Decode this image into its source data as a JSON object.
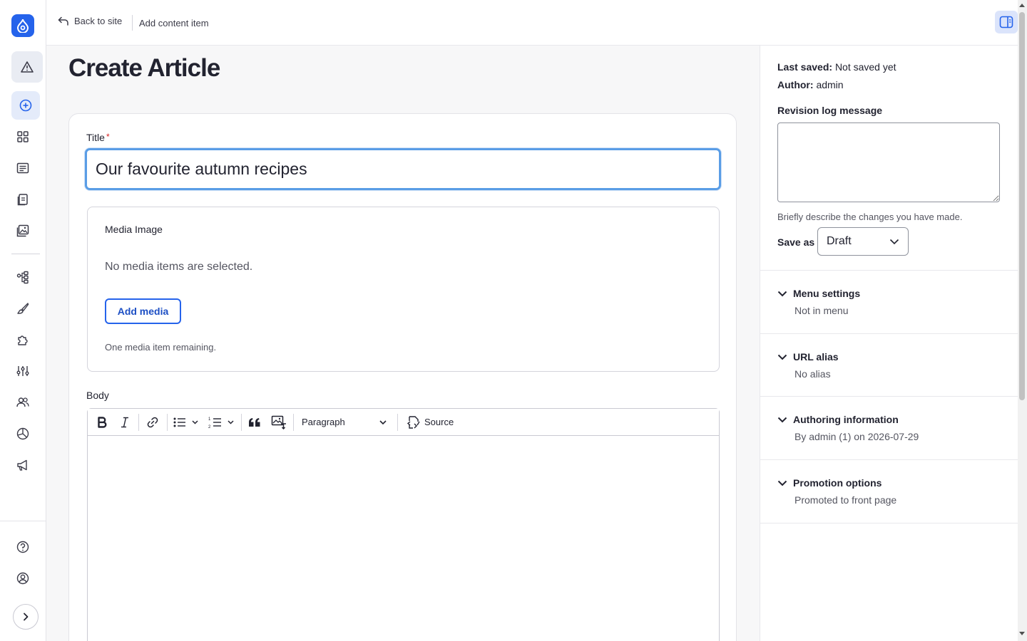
{
  "topbar": {
    "back_label": "Back to site",
    "breadcrumb": "Add content item"
  },
  "page": {
    "title": "Create Article"
  },
  "form": {
    "title_label": "Title",
    "required_mark": "*",
    "title_value": "Our favourite autumn recipes",
    "media": {
      "label": "Media Image",
      "empty_text": "No media items are selected.",
      "add_button": "Add media",
      "remaining": "One media item remaining."
    },
    "body_label": "Body",
    "editor": {
      "paragraph_format": "Paragraph",
      "source_label": "Source"
    }
  },
  "sidebar_panel": {
    "last_saved_label": "Last saved:",
    "last_saved_value": "Not saved yet",
    "author_label": "Author:",
    "author_value": "admin",
    "revision_label": "Revision log message",
    "revision_help": "Briefly describe the changes you have made.",
    "save_as_label": "Save as",
    "save_as_value": "Draft",
    "sections": [
      {
        "title": "Menu settings",
        "summary": "Not in menu"
      },
      {
        "title": "URL alias",
        "summary": "No alias"
      },
      {
        "title": "Authoring information",
        "summary": "By admin (1) on 2026-07-29"
      },
      {
        "title": "Promotion options",
        "summary": "Promoted to front page"
      }
    ]
  },
  "colors": {
    "accent": "#2563eb",
    "focus_ring": "#5a9de6",
    "required": "#d72222"
  }
}
